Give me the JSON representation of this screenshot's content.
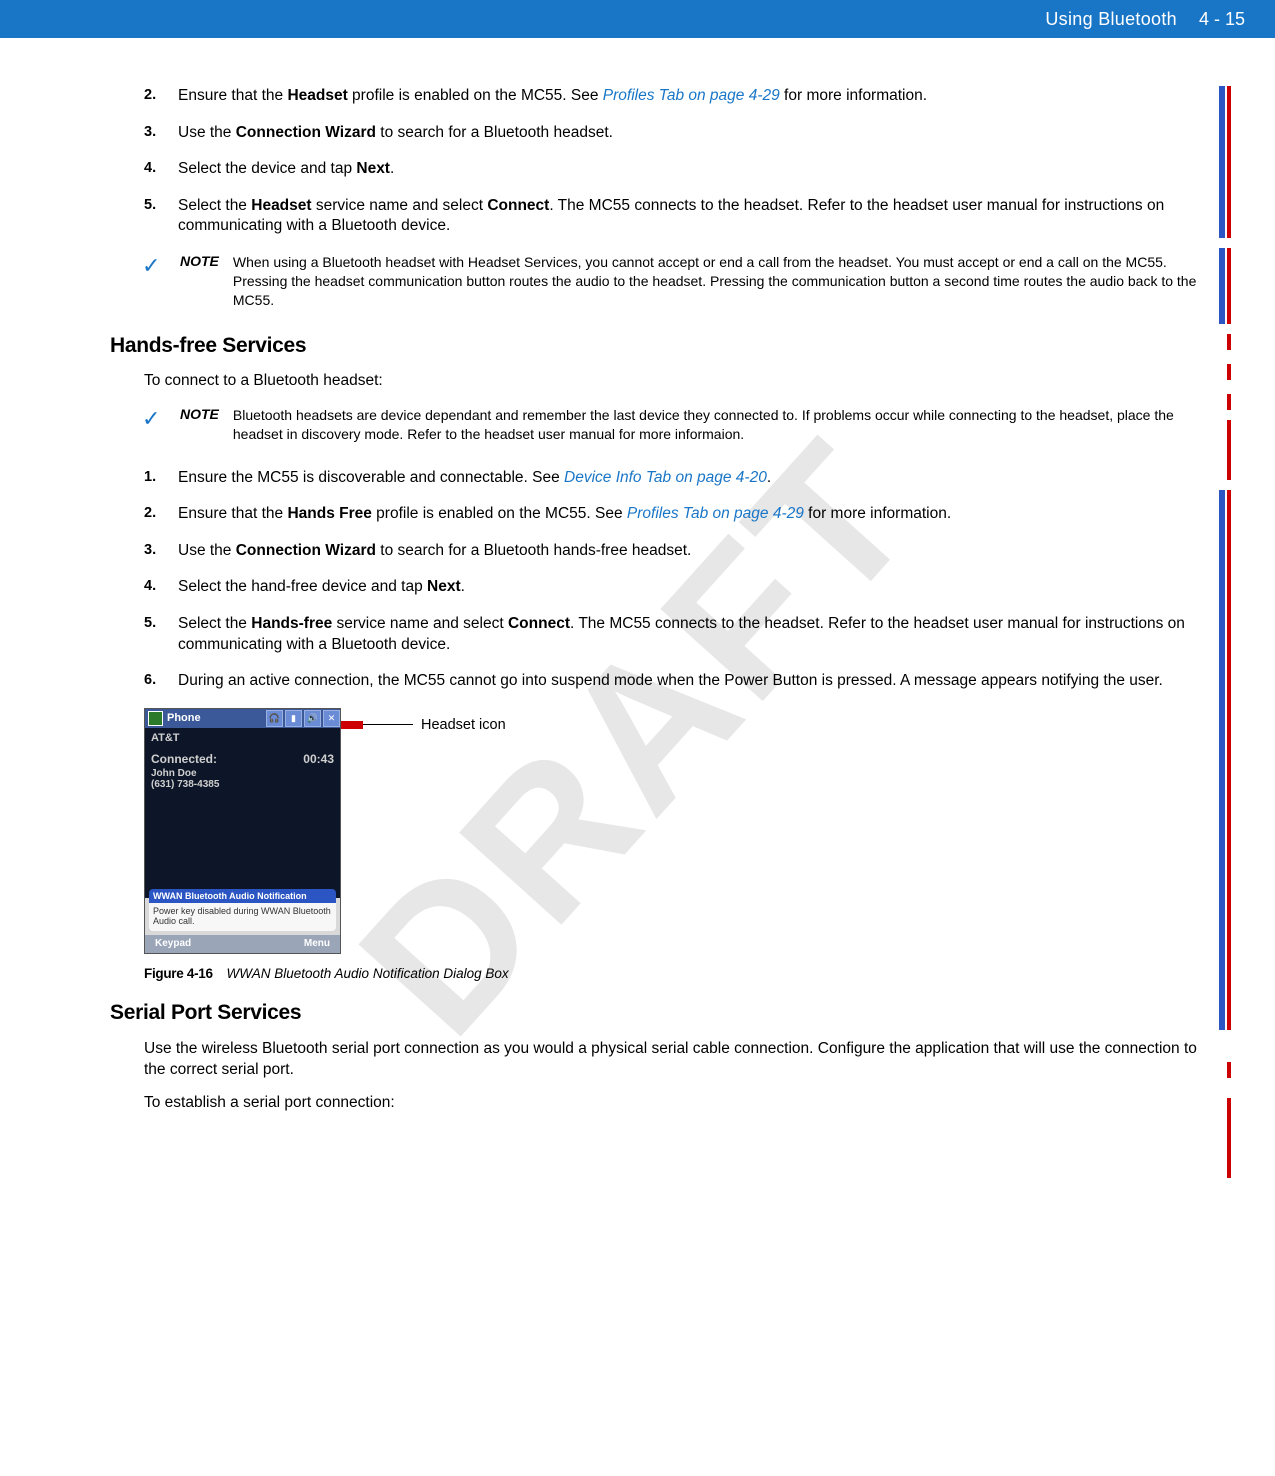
{
  "header": {
    "chapter_title": "Using Bluetooth",
    "pagenum": "4 - 15"
  },
  "watermark": "DRAFT",
  "top_steps": [
    {
      "num": "2.",
      "segments": [
        {
          "t": "Ensure that the "
        },
        {
          "t": "Headset",
          "b": true
        },
        {
          "t": " profile is enabled on the MC55. See "
        },
        {
          "t": "Profiles Tab on page 4-29",
          "link": true
        },
        {
          "t": " for more information."
        }
      ]
    },
    {
      "num": "3.",
      "segments": [
        {
          "t": "Use the "
        },
        {
          "t": "Connection Wizard",
          "b": true
        },
        {
          "t": " to search for a Bluetooth headset."
        }
      ]
    },
    {
      "num": "4.",
      "segments": [
        {
          "t": "Select the device and tap "
        },
        {
          "t": "Next",
          "b": true
        },
        {
          "t": "."
        }
      ]
    },
    {
      "num": "5.",
      "segments": [
        {
          "t": "Select the "
        },
        {
          "t": "Headset",
          "b": true
        },
        {
          "t": " service name and select "
        },
        {
          "t": "Connect",
          "b": true
        },
        {
          "t": ". The MC55 connects to the headset. Refer to the headset user manual for instructions on communicating with a Bluetooth device."
        }
      ]
    }
  ],
  "note1": {
    "label": "NOTE",
    "text": "When using a Bluetooth headset with Headset Services, you cannot accept or end a call from the headset. You must accept or end a call on the MC55. Pressing the headset communication button routes the audio to the headset. Pressing the communication button a second time routes the audio back to the MC55."
  },
  "heading1": "Hands-free Services",
  "intro1": "To connect to a Bluetooth headset:",
  "note2": {
    "label": "NOTE",
    "text": "Bluetooth headsets are device dependant and remember the last device they connected to. If problems occur while connecting to the headset, place the headset in discovery mode. Refer to the headset user manual for more informaion."
  },
  "hf_steps": [
    {
      "num": "1.",
      "segments": [
        {
          "t": "Ensure the MC55 is discoverable and connectable. See "
        },
        {
          "t": "Device Info Tab on page 4-20",
          "link": true
        },
        {
          "t": "."
        }
      ]
    },
    {
      "num": "2.",
      "segments": [
        {
          "t": "Ensure that the "
        },
        {
          "t": "Hands Free",
          "b": true
        },
        {
          "t": " profile is enabled on the MC55. See "
        },
        {
          "t": "Profiles Tab on page 4-29",
          "link": true
        },
        {
          "t": " for more information."
        }
      ]
    },
    {
      "num": "3.",
      "segments": [
        {
          "t": "Use the "
        },
        {
          "t": "Connection Wizard",
          "b": true
        },
        {
          "t": " to search for a Bluetooth hands-free headset."
        }
      ]
    },
    {
      "num": "4.",
      "segments": [
        {
          "t": "Select the hand-free device and tap "
        },
        {
          "t": "Next",
          "b": true
        },
        {
          "t": "."
        }
      ]
    },
    {
      "num": "5.",
      "segments": [
        {
          "t": "Select the "
        },
        {
          "t": "Hands-free",
          "b": true
        },
        {
          "t": " service name and select "
        },
        {
          "t": "Connect",
          "b": true
        },
        {
          "t": ". The MC55 connects to the headset. Refer to the headset user manual for instructions on communicating with a Bluetooth device."
        }
      ]
    },
    {
      "num": "6.",
      "segments": [
        {
          "t": "During an active connection, the MC55 cannot go into suspend mode when the Power Button is pressed. A message appears notifying the user."
        }
      ]
    }
  ],
  "figure": {
    "shot": {
      "title": "Phone",
      "carrier": "AT&T",
      "connected_label": "Connected:",
      "timer": "00:43",
      "name": "John Doe",
      "phone": "(631) 738-4385",
      "notif_header": "WWAN Bluetooth Audio Notification",
      "notif_body": "Power key disabled during WWAN Bluetooth Audio call.",
      "menu_left": "Keypad",
      "menu_right": "Menu"
    },
    "callout_label": "Headset icon",
    "caption_num": "Figure 4-16",
    "caption_text": "WWAN Bluetooth Audio Notification Dialog Box"
  },
  "heading2": "Serial Port Services",
  "para_sps": "Use the wireless Bluetooth serial port connection as you would a physical serial cable connection. Configure the application that will use the connection to the correct serial port.",
  "para_sps2": "To establish a serial port connection:",
  "chart_data": {
    "type": "table",
    "note": "no chart present"
  }
}
